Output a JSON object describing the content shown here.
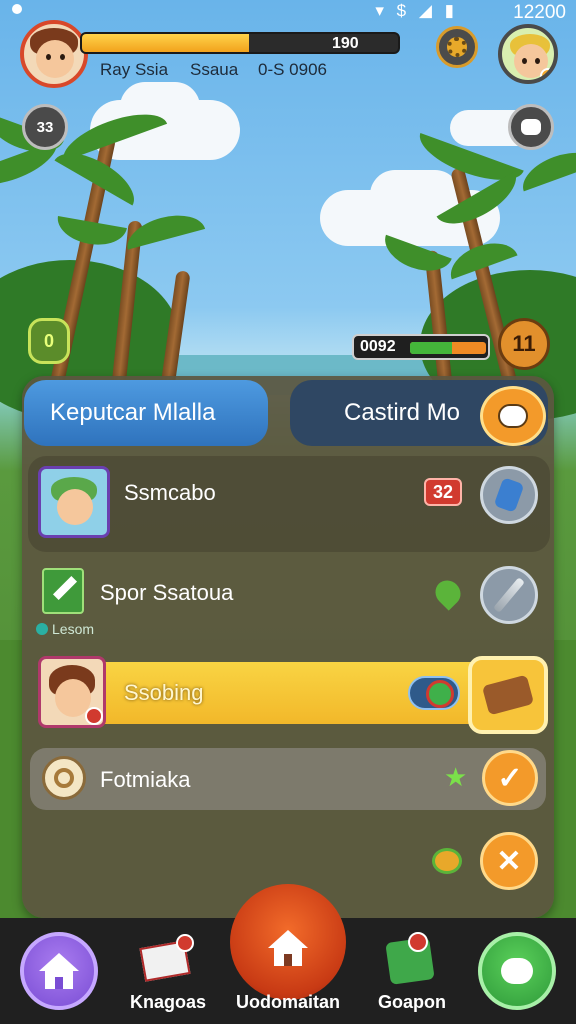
{
  "status_bar": {
    "time": "12200",
    "icons": "▾ $ ◢ ▮"
  },
  "hud": {
    "xp_value": "190",
    "xp_fraction": 0.53,
    "player_name": "Ray Ssia",
    "player_rank": "Ssaua",
    "score": "0-S 0906",
    "side_button_left": "33",
    "shield_label": "0"
  },
  "timer": {
    "value": "0092",
    "fraction": 0.55
  },
  "pause_label": "11",
  "tabs": {
    "left_label": "Keputcar Mlalla",
    "right_label": "Castird Mo"
  },
  "rows": [
    {
      "label": "Ssmcabo",
      "count": "32"
    },
    {
      "label": "Spor Ssatoua",
      "sub_label": "Lesom"
    },
    {
      "label": "Ssobing"
    },
    {
      "label": "Fotmiaka"
    }
  ],
  "nav": {
    "left_label": "Knagoas",
    "center_label": "Uodomaitan",
    "right_label": "Goapon"
  },
  "colors": {
    "accent_orange": "#f39a2a",
    "highlight_yellow": "#f7cc3a",
    "tab_blue": "#3f86d2",
    "nav_purple": "#8a5ce0",
    "nav_green": "#3fb04a"
  }
}
